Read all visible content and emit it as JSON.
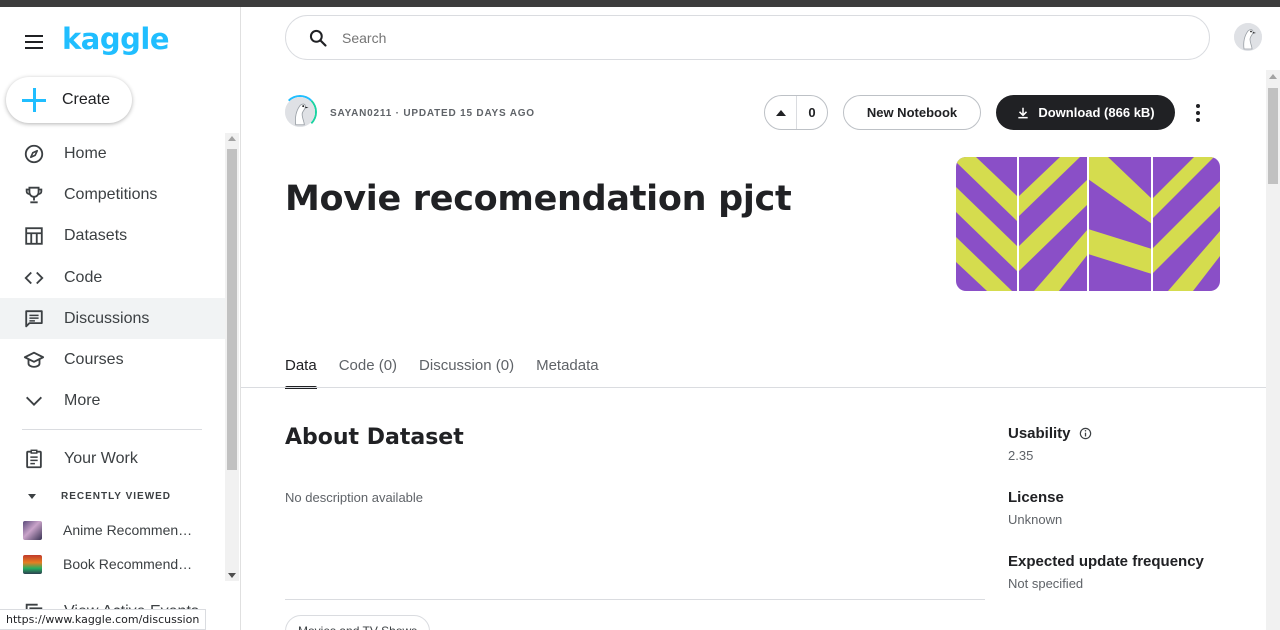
{
  "app": {
    "logo": "kaggle"
  },
  "sidebar": {
    "create_label": "Create",
    "items": [
      {
        "label": "Home",
        "icon": "compass-icon"
      },
      {
        "label": "Competitions",
        "icon": "trophy-icon"
      },
      {
        "label": "Datasets",
        "icon": "table-icon"
      },
      {
        "label": "Code",
        "icon": "code-icon"
      },
      {
        "label": "Discussions",
        "icon": "chat-icon"
      },
      {
        "label": "Courses",
        "icon": "graduation-cap-icon"
      },
      {
        "label": "More",
        "icon": "chevron-down-icon"
      }
    ],
    "your_work": "Your Work",
    "recently_viewed_header": "RECENTLY VIEWED",
    "recent": [
      {
        "label": "Anime Recommend..."
      },
      {
        "label": "Book Recommendat..."
      }
    ],
    "view_active_events": "View Active Events"
  },
  "status_bar": {
    "url": "https://www.kaggle.com/discussion"
  },
  "search": {
    "placeholder": "Search"
  },
  "dataset": {
    "owner_meta": "SAYAN0211 · UPDATED 15 DAYS AGO",
    "votes": "0",
    "new_notebook": "New Notebook",
    "download": "Download (866 kB)",
    "title": "Movie recomendation pjct",
    "banner_colors": {
      "purple": "#8a4fc7",
      "lime": "#d5dc4e"
    }
  },
  "tabs": [
    {
      "label": "Data",
      "active": true
    },
    {
      "label": "Code (0)",
      "active": false
    },
    {
      "label": "Discussion (0)",
      "active": false
    },
    {
      "label": "Metadata",
      "active": false
    }
  ],
  "about": {
    "title": "About Dataset",
    "description": "No description available",
    "tag": "Movies and TV Shows"
  },
  "meta": {
    "usability_label": "Usability",
    "usability_value": "2.35",
    "license_label": "License",
    "license_value": "Unknown",
    "frequency_label": "Expected update frequency",
    "frequency_value": "Not specified"
  },
  "colors": {
    "accent": "#20beff",
    "dark": "#202124"
  }
}
